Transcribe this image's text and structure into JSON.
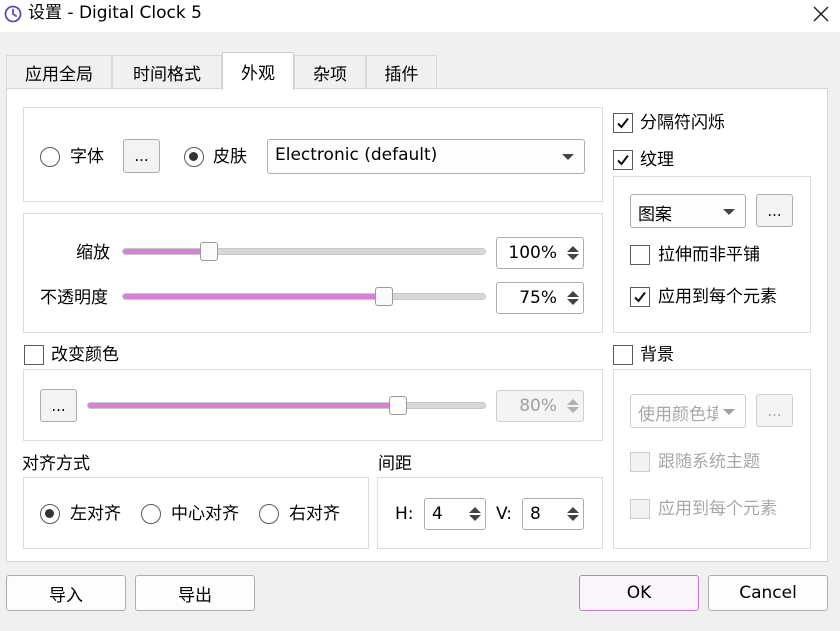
{
  "window": {
    "title": "设置 - Digital Clock 5",
    "icon": "clock-icon"
  },
  "tabs": [
    {
      "label": "应用全局"
    },
    {
      "label": "时间格式"
    },
    {
      "label": "外观",
      "active": true
    },
    {
      "label": "杂项"
    },
    {
      "label": "插件"
    }
  ],
  "font_row": {
    "font_label": "字体",
    "font_selected": false,
    "browse_label": "...",
    "skin_label": "皮肤",
    "skin_selected": true,
    "skin_value": "Electronic (default)"
  },
  "scale": {
    "label": "缩放",
    "value": "100%",
    "level": 0.24
  },
  "opacity": {
    "label": "不透明度",
    "value": "75%",
    "level": 0.72
  },
  "change_color": {
    "label": "改变颜色",
    "checked": false,
    "browse_label": "...",
    "value": "80%",
    "level": 0.78
  },
  "alignment": {
    "label": "对齐方式",
    "options": [
      {
        "label": "左对齐",
        "selected": true
      },
      {
        "label": "中心对齐",
        "selected": false
      },
      {
        "label": "右对齐",
        "selected": false
      }
    ]
  },
  "spacing": {
    "label": "间距",
    "h_label": "H:",
    "h_value": "4",
    "v_label": "V:",
    "v_value": "8"
  },
  "right": {
    "separator_blink": {
      "label": "分隔符闪烁",
      "checked": true
    },
    "texture": {
      "label": "纹理",
      "checked": true
    },
    "texture_type": "图案",
    "texture_browse": "...",
    "stretch": {
      "label": "拉伸而非平铺",
      "checked": false
    },
    "apply_each": {
      "label": "应用到每个元素",
      "checked": true
    },
    "background": {
      "label": "背景",
      "checked": false
    },
    "bg_type": "使用颜色填",
    "bg_browse": "...",
    "follow_theme": {
      "label": "跟随系统主题",
      "checked": false
    },
    "bg_apply_each": {
      "label": "应用到每个元素",
      "checked": false
    }
  },
  "footer": {
    "import_label": "导入",
    "export_label": "导出",
    "ok_label": "OK",
    "cancel_label": "Cancel"
  },
  "colors": {
    "accent": "#d680d8",
    "default_button_border": "#c07cc6"
  }
}
